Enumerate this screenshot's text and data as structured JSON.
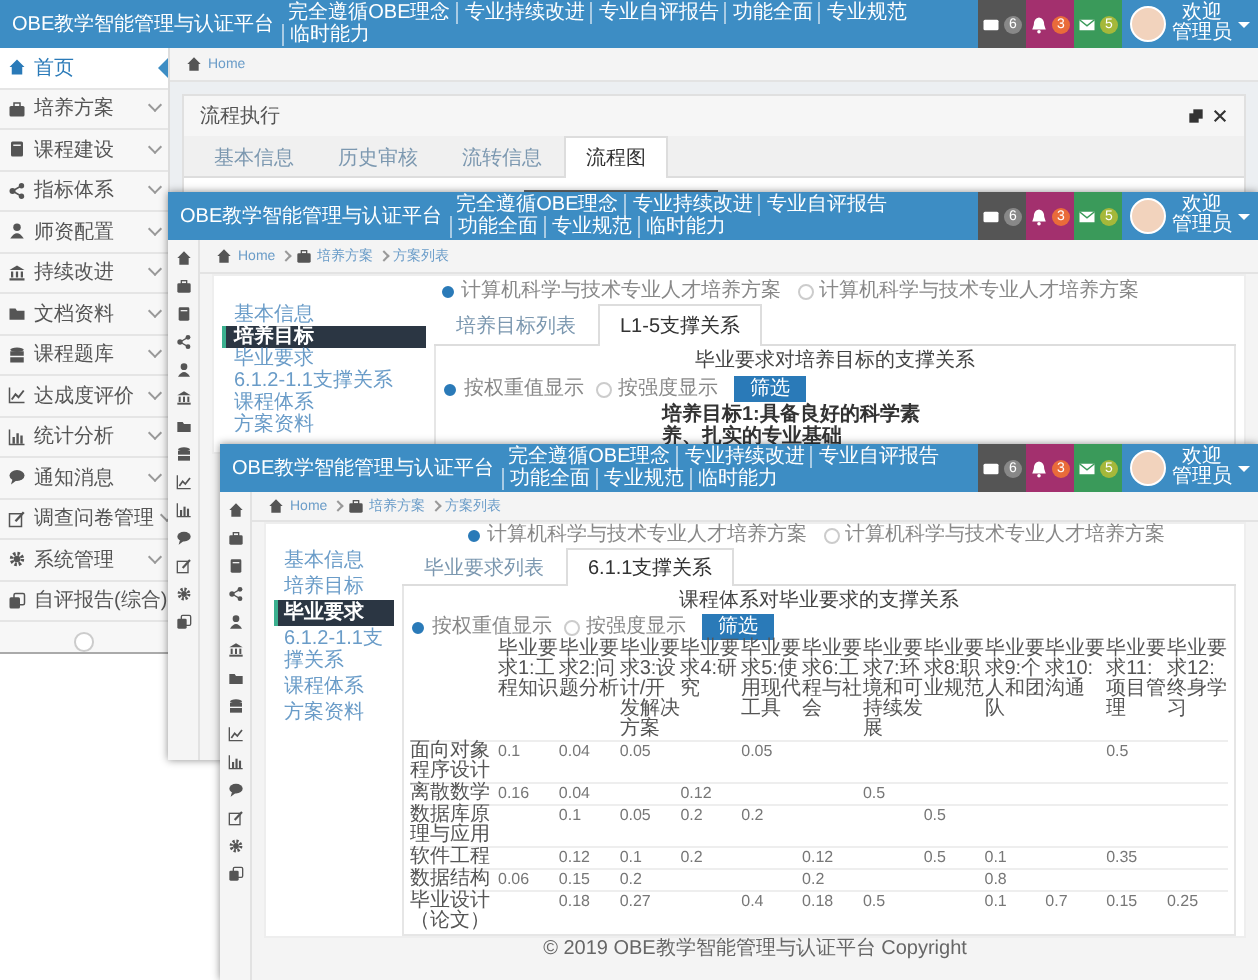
{
  "back_window": {
    "header": {
      "brand": "OBE教学智能管理与认证平台",
      "nav": [
        "完全遵循OBE理念",
        "专业持续改进",
        "专业自评报告",
        "功能全面",
        "专业规范",
        "临时能力"
      ],
      "badges": [
        {
          "count": "6"
        },
        {
          "count": "3"
        },
        {
          "count": "5"
        }
      ],
      "user": {
        "greeting": "欢迎",
        "name": "管理员"
      }
    },
    "sidebar": {
      "items": [
        {
          "label": "首页",
          "selected": true
        },
        {
          "label": "培养方案",
          "selected": false
        },
        {
          "label": "课程建设",
          "selected": false
        },
        {
          "label": "指标体系",
          "selected": false
        },
        {
          "label": "师资配置",
          "selected": false
        },
        {
          "label": "持续改进",
          "selected": false
        },
        {
          "label": "文档资料",
          "selected": false
        },
        {
          "label": "课程题库",
          "selected": false
        },
        {
          "label": "达成度评价",
          "selected": false
        },
        {
          "label": "统计分析",
          "selected": false
        },
        {
          "label": "通知消息",
          "selected": false
        },
        {
          "label": "调查问卷管理",
          "selected": false
        },
        {
          "label": "系统管理",
          "selected": false
        },
        {
          "label": "自评报告(综合)",
          "selected": false
        }
      ]
    },
    "breadcrumb": [
      "Home"
    ],
    "panel": {
      "title": "流程执行",
      "tabs": [
        {
          "label": "基本信息",
          "selected": false
        },
        {
          "label": "历史审核",
          "selected": false
        },
        {
          "label": "流转信息",
          "selected": false
        },
        {
          "label": "流程图",
          "selected": true
        }
      ]
    }
  },
  "middle_window": {
    "header": {
      "brand": "OBE教学智能管理与认证平台",
      "nav": [
        "完全遵循OBE理念",
        "专业持续改进",
        "专业自评报告",
        "功能全面",
        "专业规范",
        "临时能力"
      ],
      "badges": [
        {
          "count": "6"
        },
        {
          "count": "3"
        },
        {
          "count": "5"
        }
      ],
      "user": {
        "greeting": "欢迎",
        "name": "管理员"
      }
    },
    "breadcrumb": [
      "Home",
      "培养方案",
      "方案列表"
    ],
    "plan_options": [
      {
        "label": "计算机科学与技术专业人才培养方案",
        "selected": true
      },
      {
        "label": "计算机科学与技术专业人才培养方案",
        "selected": false
      }
    ],
    "menu": [
      {
        "label": "基本信息",
        "selected": false
      },
      {
        "label": "培养目标",
        "selected": true
      },
      {
        "label": "毕业要求",
        "selected": false
      },
      {
        "label": "6.1.2-1.1支撑关系",
        "selected": false
      },
      {
        "label": "课程体系",
        "selected": false
      },
      {
        "label": "方案资料",
        "selected": false
      }
    ],
    "tabs": [
      {
        "label": "培养目标列表",
        "selected": false
      },
      {
        "label": "L1-5支撑关系",
        "selected": true
      }
    ],
    "heading": "毕业要求对培养目标的支撑关系",
    "display_options": [
      {
        "label": "按权重值显示",
        "selected": true
      },
      {
        "label": "按强度显示",
        "selected": false
      }
    ],
    "filter_button": "筛选",
    "note": "培养目标1:具备良好的科学素养、扎实的专业基础"
  },
  "front_window": {
    "header": {
      "brand": "OBE教学智能管理与认证平台",
      "nav": [
        "完全遵循OBE理念",
        "专业持续改进",
        "专业自评报告",
        "功能全面",
        "专业规范",
        "临时能力"
      ],
      "badges": [
        {
          "count": "6"
        },
        {
          "count": "3"
        },
        {
          "count": "5"
        }
      ],
      "user": {
        "greeting": "欢迎",
        "name": "管理员"
      }
    },
    "breadcrumb": [
      "Home",
      "培养方案",
      "方案列表"
    ],
    "plan_options": [
      {
        "label": "计算机科学与技术专业人才培养方案",
        "selected": true
      },
      {
        "label": "计算机科学与技术专业人才培养方案",
        "selected": false
      }
    ],
    "menu": [
      {
        "label": "基本信息",
        "selected": false
      },
      {
        "label": "培养目标",
        "selected": false
      },
      {
        "label": "毕业要求",
        "selected": true
      },
      {
        "label": "6.1.2-1.1支撑关系",
        "selected": false
      },
      {
        "label": "课程体系",
        "selected": false
      },
      {
        "label": "方案资料",
        "selected": false
      }
    ],
    "tabs": [
      {
        "label": "毕业要求列表",
        "selected": false
      },
      {
        "label": "6.1.1支撑关系",
        "selected": true
      }
    ],
    "heading": "课程体系对毕业要求的支撑关系",
    "display_options": [
      {
        "label": "按权重值显示",
        "selected": true
      },
      {
        "label": "按强度显示",
        "selected": false
      }
    ],
    "filter_button": "筛选",
    "table": {
      "columns": [
        "毕业要求1:工程知识",
        "毕业要求2:问题分析",
        "毕业要求3:设计/开发解决方案",
        "毕业要求4:研究",
        "毕业要求5:使用现代工具",
        "毕业要求6:工程与社会",
        "毕业要求7:环境和可持续发展",
        "毕业要求8:职业规范",
        "毕业要求9:个人和团队",
        "毕业要求10:沟通",
        "毕业要求11:项目管理",
        "毕业要求12:终身学习"
      ],
      "rows": [
        {
          "name": "面向对象程序设计",
          "values": {
            "1": "0.1",
            "2": "0.04",
            "3": "0.05",
            "5": "0.05",
            "11": "0.5"
          }
        },
        {
          "name": "离散数学",
          "values": {
            "1": "0.16",
            "2": "0.04",
            "4": "0.12",
            "7": "0.5"
          }
        },
        {
          "name": "数据库原理与应用",
          "values": {
            "2": "0.1",
            "3": "0.05",
            "4": "0.2",
            "5": "0.2",
            "8": "0.5"
          }
        },
        {
          "name": "软件工程",
          "values": {
            "2": "0.12",
            "3": "0.1",
            "4": "0.2",
            "6": "0.12",
            "8": "0.5",
            "9": "0.1",
            "11": "0.35"
          }
        },
        {
          "name": "数据结构",
          "values": {
            "1": "0.06",
            "2": "0.15",
            "3": "0.2",
            "6": "0.2",
            "9": "0.8"
          }
        },
        {
          "name": "毕业设计（论文）",
          "values": {
            "2": "0.18",
            "3": "0.27",
            "5": "0.4",
            "6": "0.18",
            "7": "0.5",
            "9": "0.1",
            "10": "0.7",
            "11": "0.15",
            "12": "0.25"
          }
        }
      ]
    },
    "footer": "© 2019 OBE教学智能管理与认证平台 Copyright"
  }
}
